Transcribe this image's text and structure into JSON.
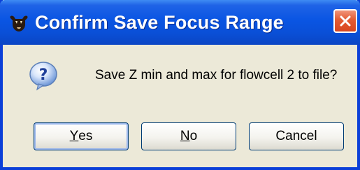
{
  "dialog": {
    "title": "Confirm Save Focus Range",
    "message": "Save Z min and max for flowcell 2 to file?",
    "buttons": {
      "yes_mnemonic": "Y",
      "yes_rest": "es",
      "no_mnemonic": "N",
      "no_rest": "o",
      "cancel": "Cancel"
    },
    "icons": {
      "app": "bull-app-icon",
      "question": "question-icon",
      "close": "close-icon"
    },
    "colors": {
      "titlebar": "#0a55e3",
      "close": "#e35b33",
      "background": "#ece9d8",
      "button_border": "#003c74"
    }
  }
}
